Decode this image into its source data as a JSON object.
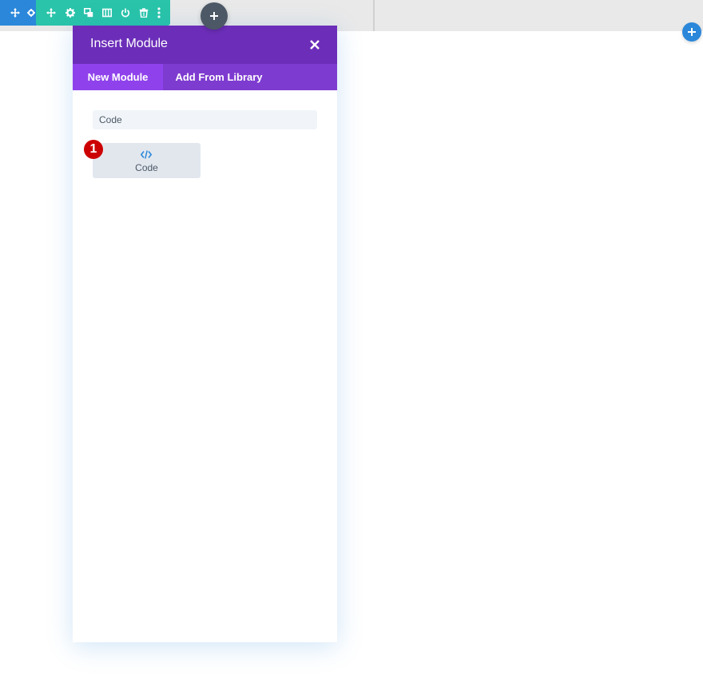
{
  "modal": {
    "title": "Insert Module",
    "close_icon": "close-icon",
    "tabs": [
      {
        "label": "New Module",
        "active": true
      },
      {
        "label": "Add From Library",
        "active": false
      }
    ],
    "search": {
      "value": "Code",
      "placeholder": ""
    },
    "modules": [
      {
        "label": "Code",
        "icon": "code-icon"
      }
    ]
  },
  "annotation": {
    "step": "1"
  },
  "toolbars": {
    "section": {
      "color": "#2b87da",
      "icons": [
        "move-icon",
        "gear-icon"
      ]
    },
    "row": {
      "color": "#29c4a9",
      "icons": [
        "move-icon",
        "gear-icon",
        "duplicate-icon",
        "columns-icon",
        "power-icon",
        "trash-icon",
        "more-icon"
      ]
    }
  },
  "colors": {
    "modal_header": "#6c2eb9",
    "tab_bar": "#7e3bd0",
    "active_tab": "#8f42ec",
    "add_row_button": "#4c5866",
    "add_module_button": "#2b87da",
    "badge": "#cc0000"
  }
}
